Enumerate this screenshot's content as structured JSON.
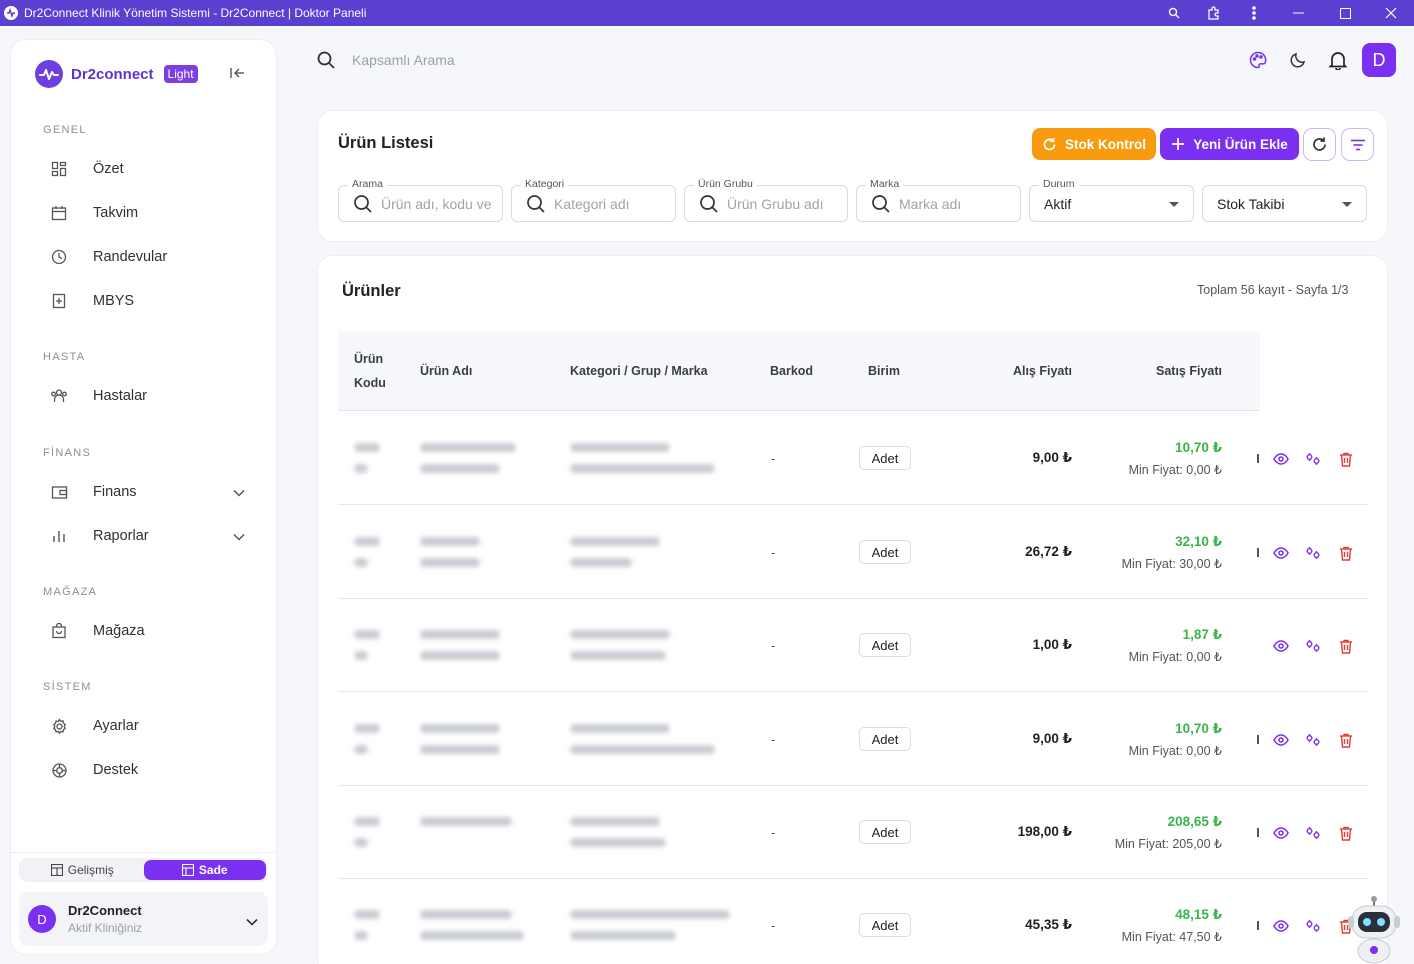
{
  "window": {
    "title": "Dr2Connect Klinik Yönetim Sistemi - Dr2Connect | Doktor Paneli"
  },
  "sidebar": {
    "brand": "Dr2connect",
    "badge": "Light",
    "sections": {
      "genel": "GENEL",
      "hasta": "HASTA",
      "finans": "FİNANS",
      "magaza": "MAĞAZA",
      "sistem": "SİSTEM"
    },
    "items": {
      "ozet": "Özet",
      "takvim": "Takvim",
      "randevular": "Randevular",
      "mbys": "MBYS",
      "hastalar": "Hastalar",
      "finans": "Finans",
      "raporlar": "Raporlar",
      "magaza": "Mağaza",
      "ayarlar": "Ayarlar",
      "destek": "Destek"
    },
    "mode": {
      "advanced": "Gelişmiş",
      "simple": "Sade",
      "selected": "Sade"
    },
    "user": {
      "initial": "D",
      "name": "Dr2Connect",
      "sub": "Aktif Kliniğiniz"
    }
  },
  "topbar": {
    "search_placeholder": "Kapsamlı Arama",
    "avatar": "D"
  },
  "product_list": {
    "title": "Ürün Listesi",
    "stock_button": "Stok Kontrol",
    "add_button": "Yeni Ürün Ekle",
    "filters": {
      "search": {
        "label": "Arama",
        "placeholder": "Ürün adı, kodu veya barkod"
      },
      "category": {
        "label": "Kategori",
        "placeholder": "Kategori adı"
      },
      "group": {
        "label": "Ürün Grubu",
        "placeholder": "Ürün Grubu adı"
      },
      "brand": {
        "label": "Marka",
        "placeholder": "Marka adı"
      },
      "status": {
        "label": "Durum",
        "value": "Aktif"
      },
      "stock": {
        "value": "Stok Takibi"
      }
    }
  },
  "products": {
    "title": "Ürünler",
    "summary": "Toplam 56 kayıt - Sayfa 1/3",
    "columns": {
      "code_line1": "Ürün",
      "code_line2": "Kodu",
      "name": "Ürün Adı",
      "category": "Kategori / Grup / Marka",
      "barcode": "Barkod",
      "unit": "Birim",
      "buy": "Alış Fiyatı",
      "sell": "Satış Fiyatı"
    },
    "rows": [
      {
        "barcode": "-",
        "unit": "Adet",
        "buy": "9,00 ₺",
        "sell": "10,70 ₺",
        "min": "Min Fiyat: 0,00 ₺"
      },
      {
        "barcode": "-",
        "unit": "Adet",
        "buy": "26,72 ₺",
        "sell": "32,10 ₺",
        "min": "Min Fiyat: 30,00 ₺"
      },
      {
        "barcode": "-",
        "unit": "Adet",
        "buy": "1,00 ₺",
        "sell": "1,87 ₺",
        "min": "Min Fiyat: 0,00 ₺"
      },
      {
        "barcode": "-",
        "unit": "Adet",
        "buy": "9,00 ₺",
        "sell": "10,70 ₺",
        "min": "Min Fiyat: 0,00 ₺"
      },
      {
        "barcode": "-",
        "unit": "Adet",
        "buy": "198,00 ₺",
        "sell": "208,65 ₺",
        "min": "Min Fiyat: 205,00 ₺"
      },
      {
        "barcode": "-",
        "unit": "Adet",
        "buy": "45,35 ₺",
        "sell": "48,15 ₺",
        "min": "Min Fiyat: 47,50 ₺"
      }
    ]
  },
  "colors": {
    "accent": "#7b2ff0",
    "warning": "#f99b0e",
    "success": "#3bb54a",
    "danger": "#e53935",
    "titlebar": "#5b3fd1"
  }
}
